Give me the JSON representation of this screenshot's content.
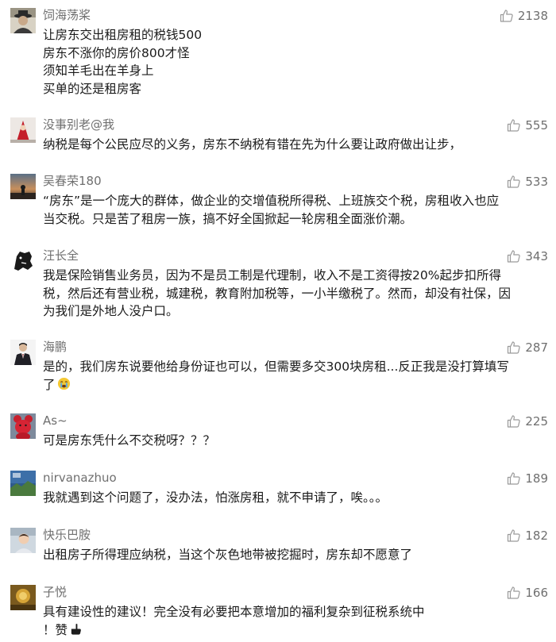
{
  "comments": [
    {
      "author": "饲海荡桨",
      "likes": "2138",
      "avatar_icon": "person-with-hat-photo",
      "lines": [
        "让房东交出租房租的税钱500",
        "房东不涨你的房价800才怪",
        "须知羊毛出在羊身上",
        "买单的还是租房客"
      ]
    },
    {
      "author": "没事别老@我",
      "likes": "555",
      "avatar_icon": "red-hooded-figure-photo",
      "lines": [
        "纳税是每个公民应尽的义务，房东不纳税有错在先为什么要让政府做出让步，"
      ]
    },
    {
      "author": "吴春荣180",
      "likes": "533",
      "avatar_icon": "sunset-silhouette-photo",
      "lines": [
        "“房东”是一个庞大的群体，做企业的交增值税所得税、上班族交个税，房租收入也应",
        "当交税。只是苦了租房一族，搞不好全国掀起一轮房租全面涨价潮。"
      ]
    },
    {
      "author": "汪长全",
      "likes": "343",
      "avatar_icon": "black-lion-emblem",
      "lines": [
        "我是保险销售业务员，因为不是员工制是代理制，收入不是工资得按20%起步扣所得",
        "税，然后还有营业税，城建税，教育附加税等，一小半缴税了。然而，却没有社保，因",
        "为我们是外地人没户口。"
      ]
    },
    {
      "author": "海鹏",
      "likes": "287",
      "avatar_icon": "man-in-suit-photo",
      "lines": [
        "是的，我们房东说要他给身份证也可以，但需要多交300块房租...反正我是没打算填写",
        "了"
      ],
      "emoji": "crying-face-emoji"
    },
    {
      "author": "As~",
      "likes": "225",
      "avatar_icon": "red-bear-toy-photo",
      "lines": [
        "可是房东凭什么不交税呀？？？"
      ]
    },
    {
      "author": "nirvanazhuo",
      "likes": "189",
      "avatar_icon": "blue-landscape-photo",
      "lines": [
        "我就遇到这个问题了，没办法，怕涨房租，就不申请了，唉。。。"
      ]
    },
    {
      "author": "快乐巴胺",
      "likes": "182",
      "avatar_icon": "child-photo",
      "lines": [
        "出租房子所得理应纳税，当这个灰色地带被挖掘时，房东却不愿意了"
      ]
    },
    {
      "author": "子悦",
      "likes": "166",
      "avatar_icon": "golden-artwork-photo",
      "lines": [
        "具有建设性的建议！完全没有必要把本意增加的福利复杂到征税系统中",
        "！赞"
      ],
      "emoji": "pointing-hand-emoji"
    }
  ]
}
